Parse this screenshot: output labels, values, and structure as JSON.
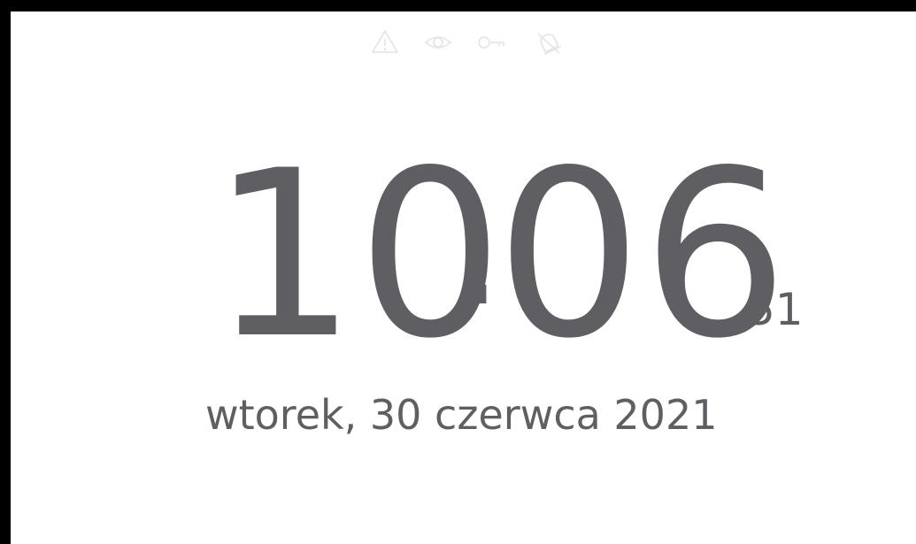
{
  "status_bar": {
    "icons": [
      {
        "name": "warning-icon",
        "label": ""
      },
      {
        "name": "eye-icon",
        "label": ""
      },
      {
        "name": "key-icon",
        "label": ""
      },
      {
        "name": "bell-off-icon",
        "label": ""
      }
    ],
    "icon_color": "#e6e6e6"
  },
  "clock": {
    "hours": "10",
    "separator": ":",
    "minutes": "06",
    "seconds": "51",
    "date": "wtorek, 30 czerwca 2021",
    "text_color": "#5f5f63"
  }
}
